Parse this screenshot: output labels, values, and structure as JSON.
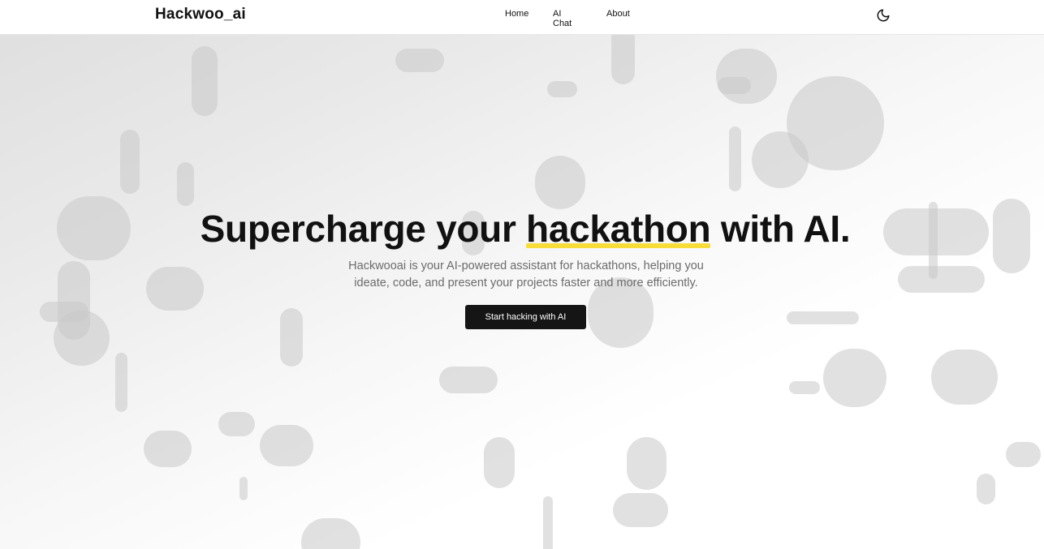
{
  "header": {
    "brand": "Hackwoo_ai",
    "nav": [
      {
        "label": "Home"
      },
      {
        "label": "AI Chat"
      },
      {
        "label": "About"
      }
    ],
    "theme_toggle_icon": "moon-icon"
  },
  "hero": {
    "headline_before": "Supercharge your ",
    "headline_highlight": "hackathon",
    "headline_after": " with AI.",
    "subtitle_line1": "Hackwooai is your AI-powered assistant for hackathons, helping you",
    "subtitle_line2": "ideate, code, and present your projects faster and more efficiently.",
    "cta_label": "Start hacking with AI"
  },
  "colors": {
    "accent_underline": "#f7dc3a",
    "button_bg": "#151515",
    "text_primary": "#111111",
    "text_muted": "#6b6b6b"
  }
}
